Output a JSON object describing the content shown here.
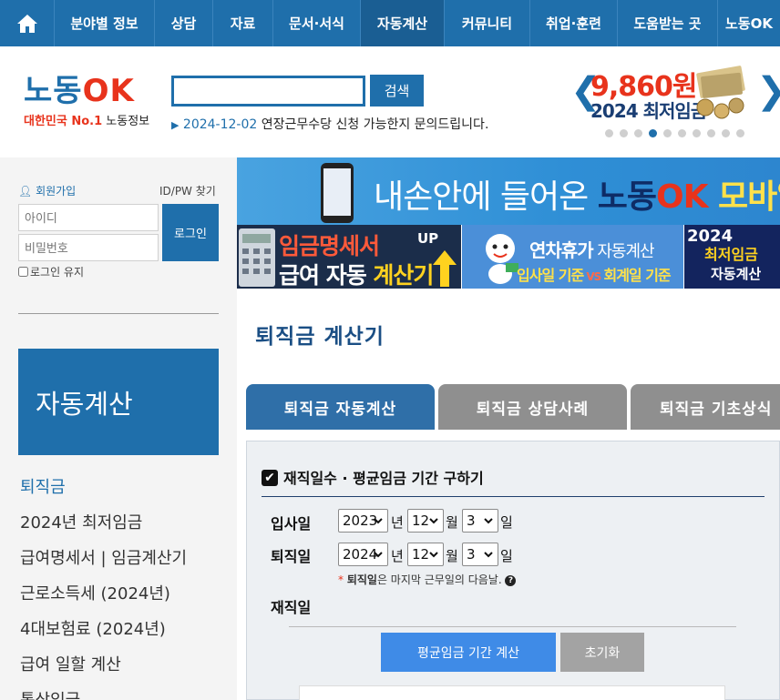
{
  "nav": {
    "items": [
      "분야별 정보",
      "상담",
      "자료",
      "문서·서식",
      "자동계산",
      "커뮤니티",
      "취업·훈련",
      "도움받는 곳",
      "노동OK"
    ],
    "active_index": 4
  },
  "logo": {
    "part1": "노동",
    "part2": "OK",
    "sub_red": "대한민국 No.1",
    "sub": " 노동정보"
  },
  "search": {
    "value": "",
    "button": "검색"
  },
  "notice": {
    "date": "2024-12-02",
    "text": "연장근무수당 신청 가능한지 문의드립니다."
  },
  "promo": {
    "price": "9,860원",
    "label": "2024 최저임금",
    "dots_total": 10,
    "dots_active": 4
  },
  "sidebar": {
    "join": "회원가입",
    "find": "ID/PW 찾기",
    "id_placeholder": "아이디",
    "pw_placeholder": "비밀번호",
    "login": "로그인",
    "keep": "로그인 유지",
    "section_title": "자동계산",
    "menu": [
      "퇴직금",
      "2024년 최저임금",
      "급여명세서 | 임금계산기",
      "근로소득세 (2024년)",
      "4대보험료 (2024년)",
      "급여 일할 계산",
      "통상임금"
    ],
    "menu_active": 0
  },
  "banners": {
    "mobile_pre": "내손안에 들어온 ",
    "mobile_b1": "노동",
    "mobile_b2": "OK",
    "mobile_b3": " 모바일앱",
    "pay_line1": "임금명세서",
    "pay_up": "UP",
    "pay_line2a": "급여 자동 ",
    "pay_line2b": "계산기",
    "leave_a": "연차휴가",
    "leave_b": " 자동계산",
    "leave_c1": "입사일 기준",
    "leave_vs": " VS ",
    "leave_c2": "회계일 기준",
    "min_year": "2024",
    "min_t1": "최저임금",
    "min_t2": "자동계산"
  },
  "page_title": "퇴직금 계산기",
  "tabs": [
    "퇴직금 자동계산",
    "퇴직금 상담사례",
    "퇴직금 기초상식"
  ],
  "form": {
    "section": "재직일수 · 평균임금 기간 구하기",
    "start_label": "입사일",
    "end_label": "퇴직일",
    "tenure_label": "재직일",
    "start_year": "2023",
    "start_month": "12",
    "start_day": "3",
    "end_year": "2024",
    "end_month": "12",
    "end_day": "3",
    "unit_year": "년",
    "unit_month": "월",
    "unit_day": "일",
    "hint_star": "* ",
    "hint_bold": "퇴직일",
    "hint_rest": "은 마지막 근무일의 다음날.",
    "btn_calc": "평균임금 기간 계산",
    "btn_reset": "초기화"
  },
  "colors": {
    "primary": "#1f6fab",
    "accent_red": "#e8331c",
    "button_blue": "#3f8be7",
    "tab_inactive": "#8f8f8f"
  }
}
